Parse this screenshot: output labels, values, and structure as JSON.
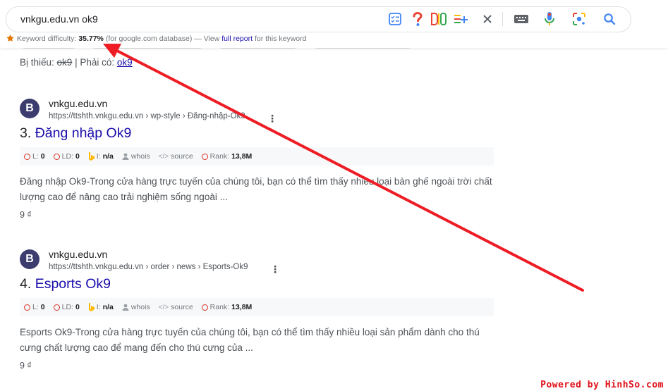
{
  "search": {
    "query": "vnkgu.edu.vn ok9",
    "icons": [
      "checklist-icon",
      "question-icon",
      "vs-icon",
      "add-list-icon",
      "close-icon",
      "keyboard-icon",
      "mic-icon",
      "lens-icon",
      "search-icon"
    ]
  },
  "keyword_bar": {
    "label": "Keyword difficulty:",
    "value": "35.77%",
    "db_note": "(for google.com database) — View",
    "link": "full report",
    "suffix": "for this keyword"
  },
  "missing": {
    "prefix": "Bị thiếu:",
    "missing_term": "ok9",
    "sep": "| Phải có:",
    "required_term": "ok9"
  },
  "results": [
    {
      "favicon_letter": "B",
      "site_name": "vnkgu.edu.vn",
      "url": "https://ttshth.vnkgu.edu.vn › wp-style › Đăng-nhập-Ok9",
      "more": "⋮",
      "rank_no": "3.",
      "title": "Đăng nhập Ok9",
      "seo": {
        "l": "L:",
        "l_val": "0",
        "ld": "LD:",
        "ld_val": "0",
        "i": "I:",
        "i_val": "n/a",
        "whois": "whois",
        "source": "source",
        "rank": "Rank:",
        "rank_val": "13,8M"
      },
      "snippet": "Đăng nhập Ok9-Trong cửa hàng trực tuyến của chúng tôi, bạn có thể tìm thấy nhiều loại bàn ghế ngoài trời chất lượng cao để nâng cao trải nghiệm sống ngoài ...",
      "price": "9 ₫"
    },
    {
      "favicon_letter": "B",
      "site_name": "vnkgu.edu.vn",
      "url": "https://ttshth.vnkgu.edu.vn › order › news › Esports-Ok9",
      "more": "⋮",
      "rank_no": "4.",
      "title": "Esports Ok9",
      "seo": {
        "l": "L:",
        "l_val": "0",
        "ld": "LD:",
        "ld_val": "0",
        "i": "I:",
        "i_val": "n/a",
        "whois": "whois",
        "source": "source",
        "rank": "Rank:",
        "rank_val": "13,8M"
      },
      "snippet": "Esports Ok9-Trong cửa hàng trực tuyến của chúng tôi, bạn có thể tìm thấy nhiều loại sản phẩm dành cho thú cưng chất lượng cao để mang đến cho thú cưng của ...",
      "price": "9 ₫"
    }
  ],
  "annotation": {
    "arrow_color": "#ee1c24"
  },
  "watermark": "Powered by HinhSo.com"
}
